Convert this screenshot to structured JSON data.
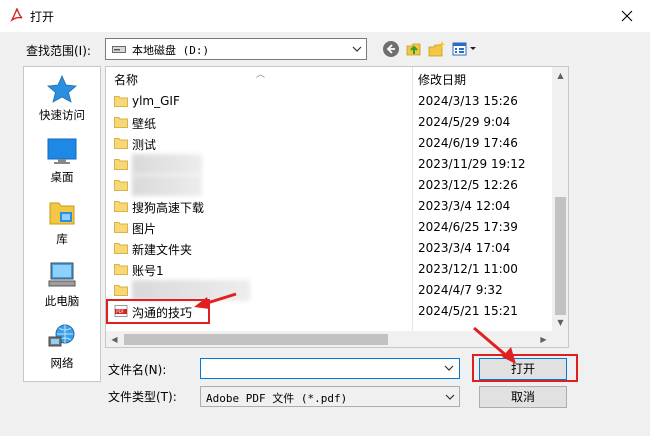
{
  "window": {
    "title": "打开",
    "app_icon": "pdf-app-icon",
    "close_icon": "close-icon"
  },
  "toolbar": {
    "lookin_label": "查找范围(I):",
    "lookin_value": "本地磁盘 (D:)",
    "buttons": [
      "back-icon",
      "up-folder-icon",
      "new-folder-icon",
      "view-menu-icon"
    ]
  },
  "places": [
    {
      "label": "快速访问",
      "icon": "star-icon"
    },
    {
      "label": "桌面",
      "icon": "desktop-icon"
    },
    {
      "label": "库",
      "icon": "library-icon"
    },
    {
      "label": "此电脑",
      "icon": "computer-icon"
    },
    {
      "label": "网络",
      "icon": "network-icon"
    }
  ],
  "filelist": {
    "columns": {
      "name": "名称",
      "date": "修改日期"
    },
    "rows": [
      {
        "name": "ylm_GIF",
        "date": "2024/3/13 15:26",
        "type": "folder"
      },
      {
        "name": "壁纸",
        "date": "2024/5/29 9:04",
        "type": "folder"
      },
      {
        "name": "测试",
        "date": "2024/6/19 17:46",
        "type": "folder"
      },
      {
        "name": "",
        "date": "2023/11/29 19:12",
        "type": "folder",
        "blurred": true
      },
      {
        "name": "",
        "date": "2023/12/5 12:26",
        "type": "folder",
        "blurred": true
      },
      {
        "name": "搜狗高速下载",
        "date": "2023/3/4 12:04",
        "type": "folder"
      },
      {
        "name": "图片",
        "date": "2024/6/25 17:39",
        "type": "folder"
      },
      {
        "name": "新建文件夹",
        "date": "2023/3/4 17:04",
        "type": "folder"
      },
      {
        "name": "账号1",
        "date": "2023/12/1 11:00",
        "type": "folder"
      },
      {
        "name": "",
        "date": "2024/4/7 9:32",
        "type": "folder",
        "blurred": true
      },
      {
        "name": "沟通的技巧",
        "date": "2024/5/21 15:21",
        "type": "pdf"
      }
    ]
  },
  "footer": {
    "filename_label": "文件名(N):",
    "filename_value": "",
    "filetype_label": "文件类型(T):",
    "filetype_value": "Adobe PDF 文件 (*.pdf)",
    "open_label": "打开",
    "cancel_label": "取消"
  },
  "colors": {
    "accent": "#0078d7",
    "annotation": "#e02020",
    "folder": "#f8d775"
  }
}
